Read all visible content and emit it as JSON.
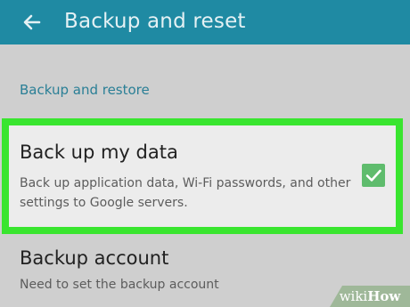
{
  "header": {
    "title": "Backup and reset",
    "back_icon": "arrow-left-icon",
    "background_color": "#1f8aa3"
  },
  "section": {
    "label": "Backup and restore"
  },
  "items": [
    {
      "title": "Back up my data",
      "description": "Back up application data, Wi-Fi passwords, and other settings to Google servers.",
      "checked": true,
      "highlight_color": "#39e52f"
    },
    {
      "title": "Backup account",
      "description": "Need to set the backup account"
    }
  ],
  "watermark": {
    "part1": "wiki",
    "part2": "How"
  }
}
